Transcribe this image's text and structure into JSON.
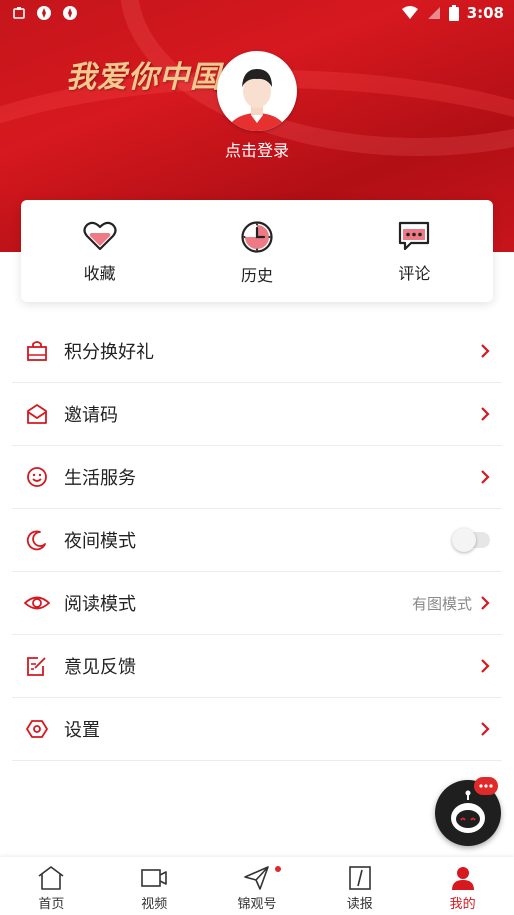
{
  "status_bar": {
    "time": "3:08"
  },
  "header": {
    "slogan": "我爱你中国",
    "login_label": "点击登录"
  },
  "quick_actions": [
    {
      "label": "收藏",
      "icon": "heart-icon"
    },
    {
      "label": "历史",
      "icon": "clock-icon"
    },
    {
      "label": "评论",
      "icon": "comment-icon"
    }
  ],
  "menu": [
    {
      "label": "积分换好礼",
      "icon": "gift-bag-icon"
    },
    {
      "label": "邀请码",
      "icon": "inbox-icon"
    },
    {
      "label": "生活服务",
      "icon": "smile-icon"
    },
    {
      "label": "夜间模式",
      "icon": "moon-icon",
      "toggle_on": false
    },
    {
      "label": "阅读模式",
      "icon": "eye-icon",
      "value": "有图模式"
    },
    {
      "label": "意见反馈",
      "icon": "edit-icon"
    },
    {
      "label": "设置",
      "icon": "settings-icon"
    }
  ],
  "tabs": [
    {
      "label": "首页",
      "icon": "home-icon"
    },
    {
      "label": "视频",
      "icon": "video-icon"
    },
    {
      "label": "锦观号",
      "icon": "send-icon"
    },
    {
      "label": "读报",
      "icon": "newspaper-icon"
    },
    {
      "label": "我的",
      "icon": "user-icon",
      "active": true
    }
  ],
  "colors": {
    "accent": "#d6181f",
    "hero": "#c4151b",
    "gold": "#f3c98f"
  }
}
